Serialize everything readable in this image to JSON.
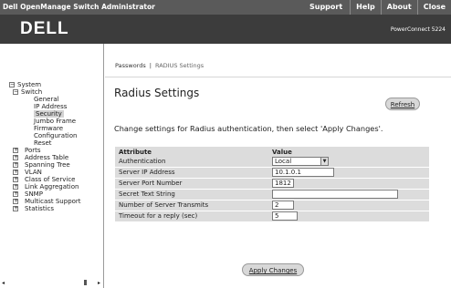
{
  "app": {
    "title": "Dell OpenManage Switch Administrator",
    "top_links": [
      "Support",
      "Help",
      "About",
      "Close"
    ],
    "logo": "DELL",
    "model": "PowerConnect 5224"
  },
  "sidebar": {
    "tree": [
      {
        "label": "System",
        "box": "−",
        "sel": false
      },
      {
        "label": "Switch",
        "box": "−",
        "sel": false
      },
      {
        "label": "General",
        "box": "",
        "sel": false
      },
      {
        "label": "IP Address",
        "box": "",
        "sel": false
      },
      {
        "label": "Security",
        "box": "",
        "sel": true
      },
      {
        "label": "Jumbo Frame",
        "box": "",
        "sel": false
      },
      {
        "label": "Firmware",
        "box": "",
        "sel": false
      },
      {
        "label": "Configuration",
        "box": "",
        "sel": false
      },
      {
        "label": "Reset",
        "box": "",
        "sel": false
      },
      {
        "label": "Ports",
        "box": "+",
        "sel": false
      },
      {
        "label": "Address Table",
        "box": "+",
        "sel": false
      },
      {
        "label": "Spanning Tree",
        "box": "+",
        "sel": false
      },
      {
        "label": "VLAN",
        "box": "+",
        "sel": false
      },
      {
        "label": "Class of Service",
        "box": "+",
        "sel": false
      },
      {
        "label": "Link Aggregation",
        "box": "+",
        "sel": false
      },
      {
        "label": "SNMP",
        "box": "+",
        "sel": false
      },
      {
        "label": "Multicast Support",
        "box": "+",
        "sel": false
      },
      {
        "label": "Statistics",
        "box": "+",
        "sel": false
      }
    ],
    "scroll_left": "◂",
    "scroll_right": "▸"
  },
  "main": {
    "breadcrumb": [
      "Passwords",
      "RADIUS Settings"
    ],
    "breadcrumb_sep": "|",
    "title": "Radius Settings",
    "refresh_label": "Refresh",
    "instructions": "Change settings for Radius authentication, then select 'Apply Changes'.",
    "table": {
      "header_attribute": "Attribute",
      "header_value": "Value",
      "rows": [
        {
          "label": "Authentication",
          "value": "Local"
        },
        {
          "label": "Server IP Address",
          "value": "10.1.0.1"
        },
        {
          "label": "Server Port Number",
          "value": "1812"
        },
        {
          "label": "Secret Text String",
          "value": ""
        },
        {
          "label": "Number of Server Transmits",
          "value": "2"
        },
        {
          "label": "Timeout for a reply (sec)",
          "value": "5"
        }
      ]
    },
    "apply_label": "Apply Changes"
  }
}
